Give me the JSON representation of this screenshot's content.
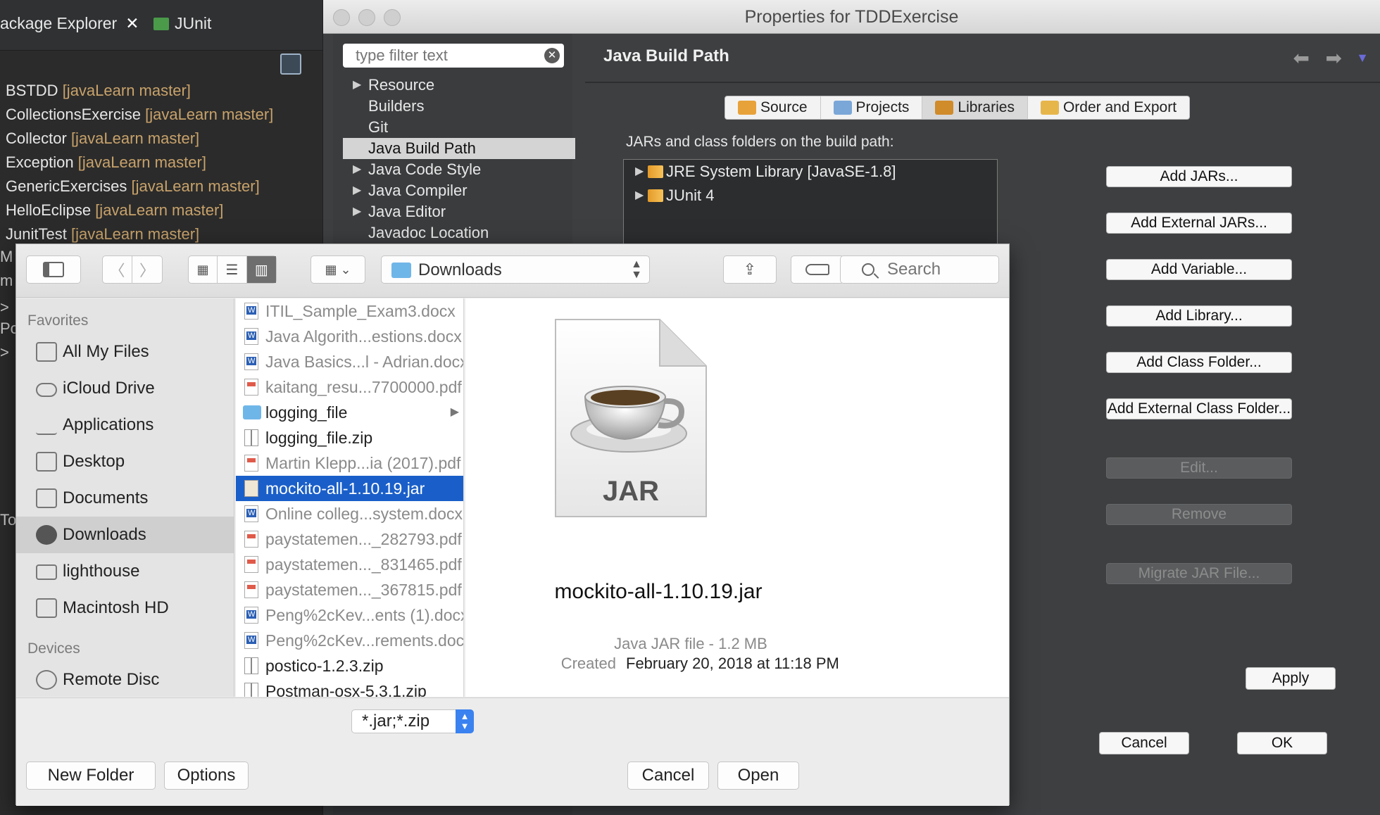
{
  "background": {
    "tabs": {
      "package_explorer": "ackage Explorer",
      "close_symbol": "✕",
      "junit": "JUnit"
    },
    "projects": [
      {
        "name": "BSTDD",
        "repo": "[javaLearn master]"
      },
      {
        "name": "CollectionsExercise",
        "repo": "[javaLearn master]"
      },
      {
        "name": "Collector",
        "repo": "[javaLearn master]"
      },
      {
        "name": "Exception",
        "repo": "[javaLearn master]"
      },
      {
        "name": "GenericExercises",
        "repo": "[javaLearn master]"
      },
      {
        "name": "HelloEclipse",
        "repo": "[javaLearn master]"
      },
      {
        "name": "JunitTest",
        "repo": "[javaLearn master]"
      }
    ],
    "left_fragments": [
      "M",
      "m",
      ">",
      "Po",
      ">",
      "To"
    ]
  },
  "properties": {
    "title": "Properties for TDDExercise",
    "filter_placeholder": "type filter text",
    "tree": [
      {
        "label": "Resource",
        "expandable": true
      },
      {
        "label": "Builders",
        "expandable": false
      },
      {
        "label": "Git",
        "expandable": false
      },
      {
        "label": "Java Build Path",
        "expandable": false,
        "selected": true
      },
      {
        "label": "Java Code Style",
        "expandable": true
      },
      {
        "label": "Java Compiler",
        "expandable": true
      },
      {
        "label": "Java Editor",
        "expandable": true
      },
      {
        "label": "Javadoc Location",
        "expandable": false
      }
    ],
    "page_title": "Java Build Path",
    "tabs": [
      {
        "label": "Source",
        "icon": "source-folder-icon",
        "color": "#e8a23a"
      },
      {
        "label": "Projects",
        "icon": "projects-folder-icon",
        "color": "#7aa7d8"
      },
      {
        "label": "Libraries",
        "icon": "libraries-icon",
        "color": "#d08b2a",
        "active": true
      },
      {
        "label": "Order and Export",
        "icon": "order-export-icon",
        "color": "#e7b64b"
      }
    ],
    "build_path_label": "JARs and class folders on the build path:",
    "libraries": [
      {
        "label": "JRE System Library [JavaSE-1.8]"
      },
      {
        "label": "JUnit 4"
      }
    ],
    "buttons": {
      "add_jars": "Add JARs...",
      "add_external_jars": "Add External JARs...",
      "add_variable": "Add Variable...",
      "add_library": "Add Library...",
      "add_class_folder": "Add Class Folder...",
      "add_external_class_folder": "Add External Class Folder...",
      "edit": "Edit...",
      "remove": "Remove",
      "migrate_jar": "Migrate JAR File...",
      "apply": "Apply",
      "cancel": "Cancel",
      "ok": "OK"
    }
  },
  "file_dialog": {
    "location": "Downloads",
    "search_placeholder": "Search",
    "sidebar": {
      "favorites_header": "Favorites",
      "favorites": [
        {
          "label": "All My Files",
          "icon": "all-files-icon"
        },
        {
          "label": "iCloud Drive",
          "icon": "cloud-icon"
        },
        {
          "label": "Applications",
          "icon": "applications-icon"
        },
        {
          "label": "Desktop",
          "icon": "desktop-icon"
        },
        {
          "label": "Documents",
          "icon": "documents-icon"
        },
        {
          "label": "Downloads",
          "icon": "downloads-icon",
          "selected": true
        },
        {
          "label": "lighthouse",
          "icon": "folder-icon"
        },
        {
          "label": "Macintosh HD",
          "icon": "hard-drive-icon"
        }
      ],
      "devices_header": "Devices",
      "devices": [
        {
          "label": "Remote Disc",
          "icon": "disc-icon"
        }
      ]
    },
    "files": [
      {
        "name": "ITIL_Sample_Exam3.docx",
        "type": "doc",
        "enabled": false
      },
      {
        "name": "Java Algorith...estions.docx",
        "type": "doc",
        "enabled": false
      },
      {
        "name": "Java Basics...l - Adrian.docx",
        "type": "doc",
        "enabled": false
      },
      {
        "name": "kaitang_resu...7700000.pdf",
        "type": "pdf",
        "enabled": false
      },
      {
        "name": "logging_file",
        "type": "folder",
        "enabled": true
      },
      {
        "name": "logging_file.zip",
        "type": "zip",
        "enabled": true
      },
      {
        "name": "Martin Klepp...ia (2017).pdf",
        "type": "pdf",
        "enabled": false
      },
      {
        "name": "mockito-all-1.10.19.jar",
        "type": "jar",
        "enabled": true,
        "selected": true
      },
      {
        "name": "Online colleg...system.docx",
        "type": "doc",
        "enabled": false
      },
      {
        "name": "paystatemen..._282793.pdf",
        "type": "pdf",
        "enabled": false
      },
      {
        "name": "paystatemen..._831465.pdf",
        "type": "pdf",
        "enabled": false
      },
      {
        "name": "paystatemen..._367815.pdf",
        "type": "pdf",
        "enabled": false
      },
      {
        "name": "Peng%2cKev...ents (1).docx",
        "type": "doc",
        "enabled": false
      },
      {
        "name": "Peng%2cKev...rements.docx",
        "type": "doc",
        "enabled": false
      },
      {
        "name": "postico-1.2.3.zip",
        "type": "zip",
        "enabled": true
      },
      {
        "name": "Postman-osx-5.3.1.zip",
        "type": "zip",
        "enabled": true
      }
    ],
    "preview": {
      "icon_label": "JAR",
      "filename": "mockito-all-1.10.19.jar",
      "kind": "Java JAR file - 1.2 MB",
      "created_label": "Created",
      "created_value": "February 20, 2018 at 11:18 PM"
    },
    "file_type": "*.jar;*.zip",
    "buttons": {
      "new_folder": "New Folder",
      "options": "Options",
      "cancel": "Cancel",
      "open": "Open"
    }
  }
}
